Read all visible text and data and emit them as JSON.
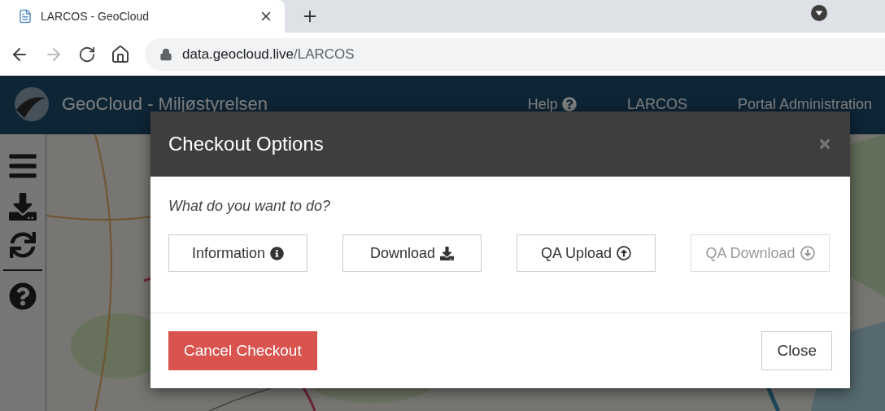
{
  "browser": {
    "tab": {
      "title": "LARCOS - GeoCloud"
    },
    "address": {
      "host": "data.geocloud.live",
      "path": "/LARCOS"
    }
  },
  "header": {
    "title": "GeoCloud - Miljøstyrelsen",
    "nav": [
      {
        "label": "Help",
        "kind": "help"
      },
      {
        "label": "LARCOS",
        "kind": "link"
      },
      {
        "label": "Portal Administration",
        "kind": "link"
      }
    ]
  },
  "dialog": {
    "title": "Checkout Options",
    "prompt": "What do you want to do?",
    "actions": [
      {
        "label": "Information",
        "kind": "info",
        "disabled": false
      },
      {
        "label": "Download",
        "kind": "download",
        "disabled": false
      },
      {
        "label": "QA Upload",
        "kind": "upload",
        "disabled": false
      },
      {
        "label": "QA Download",
        "kind": "circle-download",
        "disabled": true
      }
    ],
    "footer_buttons": [
      {
        "label": "Cancel Checkout",
        "kind": "danger"
      },
      {
        "label": "Close",
        "kind": "default"
      }
    ]
  }
}
